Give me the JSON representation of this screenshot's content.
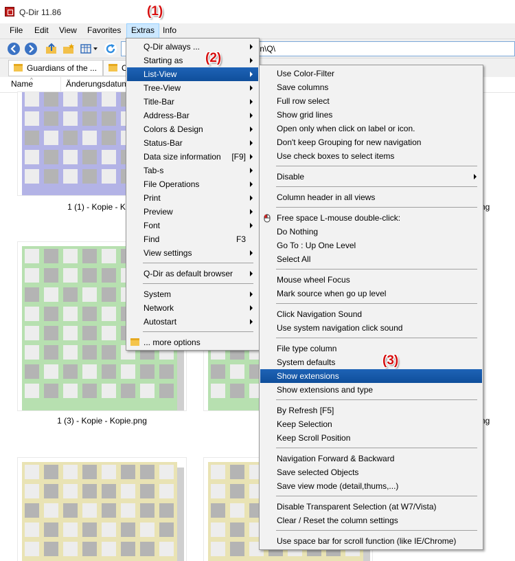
{
  "window": {
    "title": "Q-Dir 11.86"
  },
  "menubar": {
    "items": [
      "File",
      "Edit",
      "View",
      "Favorites",
      "Extras",
      "Info"
    ]
  },
  "toolbar": {
    "path": "g\\icon\\Q\\"
  },
  "tabs": [
    "Guardians of the ...",
    "C"
  ],
  "columns": {
    "name": "Name",
    "date": "Änderungsdatum"
  },
  "files": [
    {
      "caption": "1 (1) - Kopie - Kopi",
      "color": "#b3b3e6"
    },
    {
      "caption": "ng",
      "color": "#b3b3e6"
    },
    {
      "caption": "1 (3) - Kopie - Kopie.png",
      "color": "#b7e0b0"
    },
    {
      "caption": "ng",
      "color": "#b7e0b0"
    },
    {
      "color": "#e9e3b4"
    },
    {
      "color": "#e9e3b4"
    }
  ],
  "annotations": [
    "(1)",
    "(2)",
    "(3)"
  ],
  "extras_menu": [
    {
      "label": "Q-Dir always ...",
      "submenu": true
    },
    {
      "label": "Starting as",
      "submenu": true
    },
    {
      "label": "List-View",
      "submenu": true,
      "highlighted": true
    },
    {
      "label": "Tree-View",
      "submenu": true
    },
    {
      "label": "Title-Bar",
      "submenu": true
    },
    {
      "label": "Address-Bar",
      "submenu": true
    },
    {
      "label": "Colors & Design",
      "submenu": true
    },
    {
      "label": "Status-Bar",
      "submenu": true
    },
    {
      "label": "Data size information",
      "shortcut": "[F9]",
      "submenu": true
    },
    {
      "label": "Tab-s",
      "submenu": true
    },
    {
      "label": "File Operations",
      "submenu": true
    },
    {
      "label": "Print",
      "submenu": true
    },
    {
      "label": "Preview",
      "submenu": true
    },
    {
      "label": "Font",
      "submenu": true
    },
    {
      "label": "Find",
      "shortcut": "F3"
    },
    {
      "label": "View settings",
      "submenu": true
    },
    {
      "separator": true
    },
    {
      "label": "Q-Dir as default browser",
      "submenu": true
    },
    {
      "separator": true
    },
    {
      "label": "System",
      "submenu": true
    },
    {
      "label": "Network",
      "submenu": true
    },
    {
      "label": "Autostart",
      "submenu": true
    },
    {
      "separator": true
    },
    {
      "label": "... more options",
      "icon": "folder-icon"
    }
  ],
  "listview_menu": [
    {
      "label": "Use Color-Filter"
    },
    {
      "label": "Save columns"
    },
    {
      "label": "Full row select"
    },
    {
      "label": "Show grid lines"
    },
    {
      "label": "Open only when click on label or icon."
    },
    {
      "label": "Don't keep Grouping for new navigation"
    },
    {
      "label": "Use check boxes to select items"
    },
    {
      "separator": true
    },
    {
      "label": "Disable",
      "submenu": true
    },
    {
      "separator": true
    },
    {
      "label": "Column header in all views"
    },
    {
      "separator": true
    },
    {
      "label": "Free space L-mouse double-click:",
      "icon": "mouse-icon"
    },
    {
      "label": "Do Nothing"
    },
    {
      "label": "Go To : Up One Level"
    },
    {
      "label": "Select All"
    },
    {
      "separator": true
    },
    {
      "label": "Mouse wheel Focus"
    },
    {
      "label": "Mark source when go up level"
    },
    {
      "separator": true
    },
    {
      "label": "Click Navigation Sound"
    },
    {
      "label": "Use system navigation click sound"
    },
    {
      "separator": true
    },
    {
      "label": "File type column"
    },
    {
      "label": "System defaults"
    },
    {
      "label": "Show extensions",
      "highlighted": true
    },
    {
      "label": "Show extensions and type"
    },
    {
      "separator": true
    },
    {
      "label": "By Refresh [F5]"
    },
    {
      "label": "Keep Selection"
    },
    {
      "label": "Keep Scroll Position"
    },
    {
      "separator": true
    },
    {
      "label": "Navigation Forward & Backward"
    },
    {
      "label": "Save selected Objects"
    },
    {
      "label": "Save view mode (detail,thums,...)"
    },
    {
      "separator": true
    },
    {
      "label": "Disable Transparent Selection (at W7/Vista)"
    },
    {
      "label": "Clear / Reset the column settings"
    },
    {
      "separator": true
    },
    {
      "label": "Use space bar for scroll function (like IE/Chrome)"
    }
  ]
}
